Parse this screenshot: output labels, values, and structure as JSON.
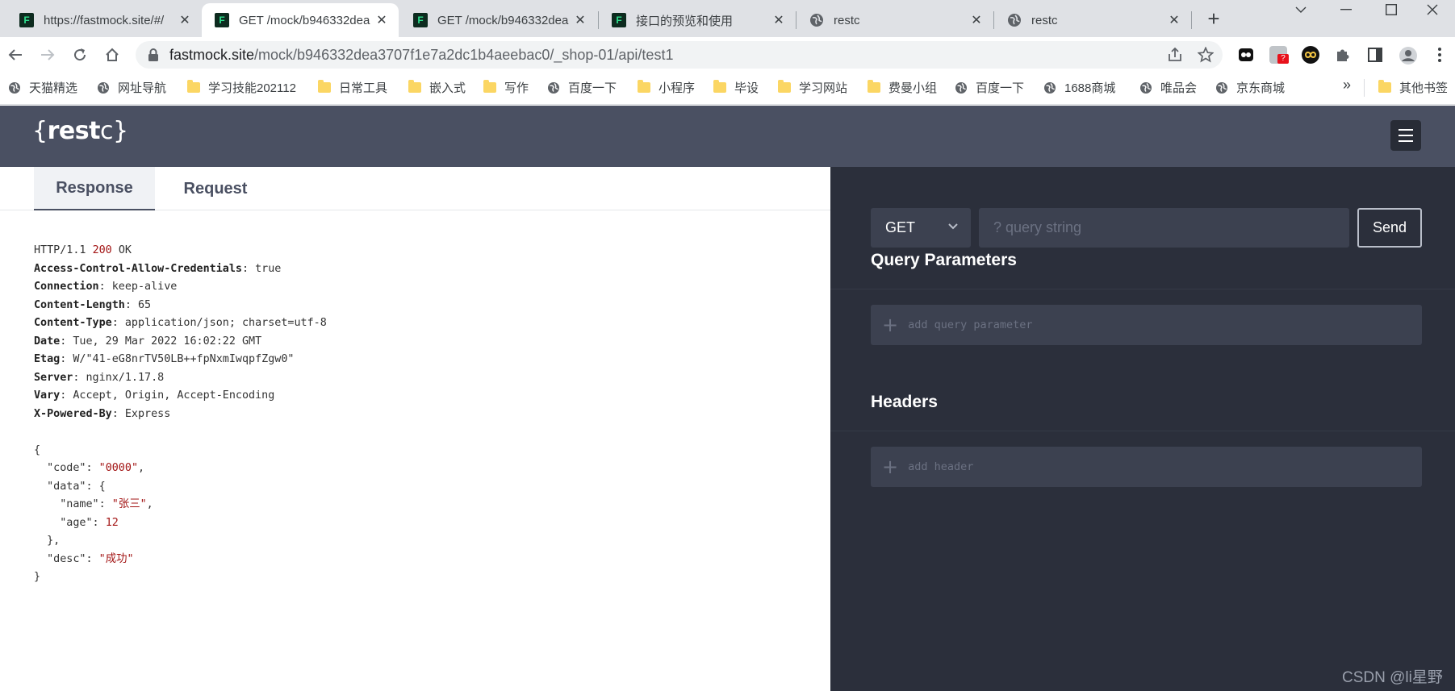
{
  "browser": {
    "tabs": [
      {
        "title": "https://fastmock.site/#/",
        "icon": "fastmock-icon",
        "active": false
      },
      {
        "title": "GET /mock/b946332dea",
        "icon": "fastmock-icon",
        "active": true
      },
      {
        "title": "GET /mock/b946332dea",
        "icon": "fastmock-icon",
        "active": false
      },
      {
        "title": "接口的预览和使用",
        "icon": "fastmock-icon",
        "active": false
      },
      {
        "title": "restc",
        "icon": "globe-icon",
        "active": false
      },
      {
        "title": "restc",
        "icon": "globe-icon",
        "active": false
      }
    ],
    "url_host": "fastmock.site",
    "url_path": "/mock/b946332dea3707f1e7a2dc1b4aeebac0/_shop-01/api/test1",
    "bookmarks": [
      {
        "label": "天猫精选",
        "icon": "globe-icon"
      },
      {
        "label": "网址导航",
        "icon": "globe-icon"
      },
      {
        "label": "学习技能202112",
        "icon": "folder-icon"
      },
      {
        "label": "日常工具",
        "icon": "folder-icon"
      },
      {
        "label": "嵌入式",
        "icon": "folder-icon"
      },
      {
        "label": "写作",
        "icon": "folder-icon"
      },
      {
        "label": "百度一下",
        "icon": "globe-icon"
      },
      {
        "label": "小程序",
        "icon": "folder-icon"
      },
      {
        "label": "毕设",
        "icon": "folder-icon"
      },
      {
        "label": "学习网站",
        "icon": "folder-icon"
      },
      {
        "label": "费曼小组",
        "icon": "folder-icon"
      },
      {
        "label": "百度一下",
        "icon": "globe-icon"
      },
      {
        "label": "1688商城",
        "icon": "globe-icon"
      },
      {
        "label": "唯品会",
        "icon": "globe-icon"
      },
      {
        "label": "京东商城",
        "icon": "globe-icon"
      }
    ],
    "more_bookmarks_symbol": "»",
    "other_bookmarks": "其他书签",
    "extension_badge": "?"
  },
  "app": {
    "logo": {
      "brace_open": "{",
      "rest": "rest",
      "c": "c",
      "brace_close": "}"
    },
    "panel_tabs": {
      "response": "Response",
      "request": "Request"
    },
    "response": {
      "status_line": {
        "proto": "HTTP/1.1",
        "code": "200",
        "text": "OK"
      },
      "headers": [
        {
          "name": "Access-Control-Allow-Credentials",
          "value": "true"
        },
        {
          "name": "Connection",
          "value": "keep-alive"
        },
        {
          "name": "Content-Length",
          "value": "65"
        },
        {
          "name": "Content-Type",
          "value": "application/json; charset=utf-8"
        },
        {
          "name": "Date",
          "value": "Tue, 29 Mar 2022 16:02:22 GMT"
        },
        {
          "name": "Etag",
          "value": "W/\"41-eG8nrTV50LB++fpNxmIwqpfZgw0\""
        },
        {
          "name": "Server",
          "value": "nginx/1.17.8"
        },
        {
          "name": "Vary",
          "value": "Accept, Origin, Accept-Encoding"
        },
        {
          "name": "X-Powered-By",
          "value": "Express"
        }
      ],
      "body": {
        "code": "0000",
        "name": "张三",
        "age": "12",
        "desc": "成功"
      }
    },
    "request": {
      "method": "GET",
      "query_placeholder": "? query string",
      "send_label": "Send",
      "query_params_title": "Query Parameters",
      "add_query_param": "add query parameter",
      "headers_title": "Headers",
      "add_header": "add header"
    },
    "watermark": "CSDN @li星野"
  }
}
